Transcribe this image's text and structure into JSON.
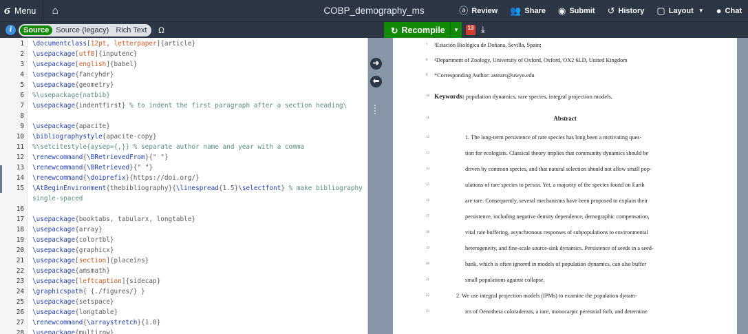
{
  "topbar": {
    "menu_label": "Menu",
    "title": "COBP_demography_ms",
    "actions": [
      {
        "icon": "review-icon",
        "glyph": "ⓐ",
        "label": "Review"
      },
      {
        "icon": "share-icon",
        "glyph": "👥",
        "label": "Share"
      },
      {
        "icon": "submit-icon",
        "glyph": "◉",
        "label": "Submit"
      },
      {
        "icon": "history-icon",
        "glyph": "↺",
        "label": "History"
      },
      {
        "icon": "layout-icon",
        "glyph": "▢",
        "label": "Layout"
      },
      {
        "icon": "chat-icon",
        "glyph": "●",
        "label": "Chat"
      }
    ]
  },
  "toolbar": {
    "modes": [
      "Source",
      "Source (legacy)",
      "Rich Text"
    ],
    "active_mode": "Source",
    "symbol_button": "Ω",
    "recompile_label": "Recompile",
    "log_badge": "13"
  },
  "editor": {
    "lines": [
      {
        "n": "1",
        "segs": [
          [
            "kw",
            "\\documentclass"
          ],
          [
            "arg",
            "["
          ],
          [
            "opt",
            "12pt, letterpaper"
          ],
          [
            "arg",
            "]{article}"
          ]
        ]
      },
      {
        "n": "2",
        "segs": [
          [
            "kw",
            "\\usepackage"
          ],
          [
            "arg",
            "["
          ],
          [
            "opt",
            "utf8"
          ],
          [
            "arg",
            "]{inputenc}"
          ]
        ]
      },
      {
        "n": "3",
        "segs": [
          [
            "kw",
            "\\usepackage"
          ],
          [
            "arg",
            "["
          ],
          [
            "opt",
            "english"
          ],
          [
            "arg",
            "]{babel}"
          ]
        ]
      },
      {
        "n": "4",
        "segs": [
          [
            "kw",
            "\\usepackage"
          ],
          [
            "arg",
            "{fancyhdr}"
          ]
        ]
      },
      {
        "n": "5",
        "segs": [
          [
            "kw",
            "\\usepackage"
          ],
          [
            "arg",
            "{geometry}"
          ]
        ]
      },
      {
        "n": "6",
        "segs": [
          [
            "cm",
            "%\\usepackage{natbib}"
          ]
        ]
      },
      {
        "n": "7",
        "segs": [
          [
            "kw",
            "\\usepackage"
          ],
          [
            "arg",
            "{indentfirst} "
          ],
          [
            "cm",
            "% to indent the first paragraph after a section heading\\"
          ]
        ]
      },
      {
        "n": "8",
        "segs": []
      },
      {
        "n": "9",
        "segs": [
          [
            "kw",
            "\\usepackage"
          ],
          [
            "arg",
            "{apacite}"
          ]
        ]
      },
      {
        "n": "10",
        "segs": [
          [
            "kw",
            "\\bibliographystyle"
          ],
          [
            "arg",
            "{apacite-copy}"
          ]
        ]
      },
      {
        "n": "11",
        "segs": [
          [
            "cm",
            "%\\setcitestyle{aysep={,}} % separate author name and year with a comma"
          ]
        ]
      },
      {
        "n": "12",
        "segs": [
          [
            "kw",
            "\\renewcommand"
          ],
          [
            "arg",
            "{"
          ],
          [
            "kw",
            "\\BRetrievedFrom"
          ],
          [
            "arg",
            "}{\" \"}"
          ]
        ]
      },
      {
        "n": "13",
        "segs": [
          [
            "kw",
            "\\renewcommand"
          ],
          [
            "arg",
            "{"
          ],
          [
            "kw",
            "\\BRetrieved"
          ],
          [
            "arg",
            "}{\" \"}"
          ]
        ]
      },
      {
        "n": "14",
        "segs": [
          [
            "kw",
            "\\renewcommand"
          ],
          [
            "arg",
            "{"
          ],
          [
            "kw",
            "\\doiprefix"
          ],
          [
            "arg",
            "}{https://doi.org/}"
          ]
        ]
      },
      {
        "n": "15",
        "segs": [
          [
            "kw",
            "\\AtBeginEnvironment"
          ],
          [
            "arg",
            "{thebibliography}{"
          ],
          [
            "kw",
            "\\linespread"
          ],
          [
            "arg",
            "{1.5}"
          ],
          [
            "kw",
            "\\selectfont"
          ],
          [
            "arg",
            "} "
          ],
          [
            "cm",
            "% make bibliography"
          ]
        ]
      },
      {
        "n": "",
        "segs": [
          [
            "cm",
            "single-spaced"
          ]
        ]
      },
      {
        "n": "16",
        "segs": []
      },
      {
        "n": "17",
        "segs": [
          [
            "kw",
            "\\usepackage"
          ],
          [
            "arg",
            "{booktabs, tabularx, longtable}"
          ]
        ]
      },
      {
        "n": "18",
        "segs": [
          [
            "kw",
            "\\usepackage"
          ],
          [
            "arg",
            "{array}"
          ]
        ]
      },
      {
        "n": "19",
        "segs": [
          [
            "kw",
            "\\usepackage"
          ],
          [
            "arg",
            "{colortbl}"
          ]
        ]
      },
      {
        "n": "20",
        "segs": [
          [
            "kw",
            "\\usepackage"
          ],
          [
            "arg",
            "{graphicx}"
          ]
        ]
      },
      {
        "n": "21",
        "segs": [
          [
            "kw",
            "\\usepackage"
          ],
          [
            "arg",
            "["
          ],
          [
            "opt",
            "section"
          ],
          [
            "arg",
            "]{placeins}"
          ]
        ]
      },
      {
        "n": "22",
        "segs": [
          [
            "kw",
            "\\usepackage"
          ],
          [
            "arg",
            "{amsmath}"
          ]
        ]
      },
      {
        "n": "23",
        "segs": [
          [
            "kw",
            "\\usepackage"
          ],
          [
            "arg",
            "["
          ],
          [
            "opt",
            "leftcaption"
          ],
          [
            "arg",
            "]{sidecap}"
          ]
        ]
      },
      {
        "n": "24",
        "segs": [
          [
            "kw",
            "\\graphicspath"
          ],
          [
            "arg",
            "{ {./figures/} }"
          ]
        ]
      },
      {
        "n": "25",
        "segs": [
          [
            "kw",
            "\\usepackage"
          ],
          [
            "arg",
            "{setspace}"
          ]
        ]
      },
      {
        "n": "26",
        "segs": [
          [
            "kw",
            "\\usepackage"
          ],
          [
            "arg",
            "{longtable}"
          ]
        ]
      },
      {
        "n": "27",
        "segs": [
          [
            "kw",
            "\\renewcommand"
          ],
          [
            "arg",
            "{"
          ],
          [
            "kw",
            "\\arraystretch"
          ],
          [
            "arg",
            "}{1.0}"
          ]
        ]
      },
      {
        "n": "28",
        "segs": [
          [
            "kw",
            "\\usepackage"
          ],
          [
            "arg",
            "{multirow}"
          ]
        ]
      }
    ]
  },
  "pdf": {
    "lines": [
      {
        "ln": "7",
        "text": "³Estación Biológica de Doñana, Sevilla, Spain;",
        "indent": 60
      },
      {
        "ln": "8",
        "text": "⁴Department of Zoology, University of Oxford, Oxford, OX2 6LD, United Kingdom",
        "indent": 60
      },
      {
        "ln": "9",
        "text": "*Corresponding Author: astears@uwyo.edu",
        "indent": 60
      },
      {
        "ln": "10",
        "keywords_label": "Keywords:",
        "text": "population dynamics, rare species, integral projection models,",
        "indent": 60
      },
      {
        "ln": "11",
        "text": "Abstract",
        "center": true
      },
      {
        "ln": "12",
        "text": "1. The long-term persistence of rare species has long been a motivating ques-",
        "indent": 105
      },
      {
        "ln": "13",
        "text": "tion for ecologists. Classical theory implies that community dynamics should be",
        "indent": 105
      },
      {
        "ln": "14",
        "text": "driven by common species, and that natural selection should not allow small pop-",
        "indent": 105
      },
      {
        "ln": "15",
        "text": "ulations of rare species to persist. Yet, a majority of the species found on Earth",
        "indent": 105
      },
      {
        "ln": "16",
        "text": "are rare. Consequently, several mechanisms have been proposed to explain their",
        "indent": 105
      },
      {
        "ln": "17",
        "text": "persistence, including negative density dependence, demographic compensation,",
        "indent": 105
      },
      {
        "ln": "18",
        "text": "vital rate buffering, asynchronous responses of subpopulations to environmental",
        "indent": 105
      },
      {
        "ln": "19",
        "text": "heterogeneity, and fine-scale source-sink dynamics. Persistence of seeds in a seed-",
        "indent": 105
      },
      {
        "ln": "20",
        "text": "bank, which is often ignored in models of population dynamics, can also buffer",
        "indent": 105
      },
      {
        "ln": "21",
        "text": "small populations against collapse.",
        "indent": 105
      },
      {
        "ln": "22",
        "text": "2. We use integral projection models (IPMs) to examine the population dynam-",
        "indent": 92
      },
      {
        "ln": "23",
        "text": "ics of Oenothera coloradensis, a rare, monocarpic perennial forb, and determine",
        "indent": 105
      }
    ]
  }
}
